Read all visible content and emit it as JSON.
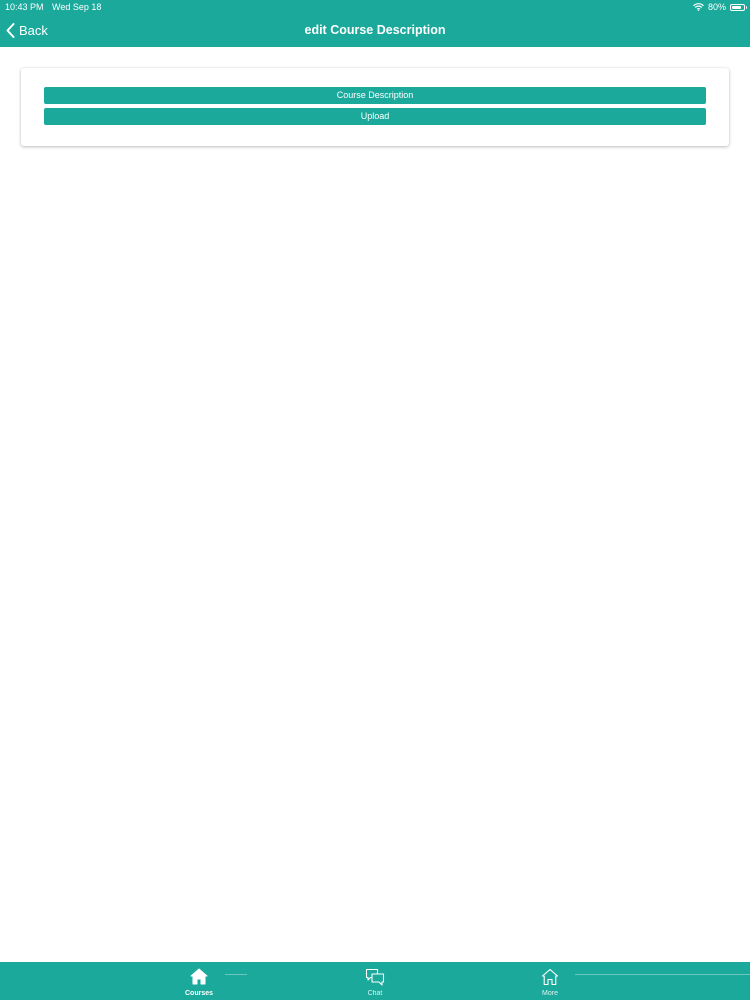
{
  "status": {
    "time": "10:43 PM",
    "date": "Wed Sep 18",
    "battery": "80%",
    "battery_level": 0.8
  },
  "nav": {
    "back_label": "Back",
    "title": "edit Course Description"
  },
  "main": {
    "buttons": [
      {
        "label": "Course Description"
      },
      {
        "label": "Upload"
      }
    ]
  },
  "tabbar": {
    "items": [
      {
        "label": "Courses",
        "icon": "home-icon",
        "active": true
      },
      {
        "label": "Chat",
        "icon": "chat-icon",
        "active": false
      },
      {
        "label": "More",
        "icon": "home-outline-icon",
        "active": false
      }
    ]
  },
  "colors": {
    "accent": "#1aa99b",
    "background": "#ffffff"
  }
}
